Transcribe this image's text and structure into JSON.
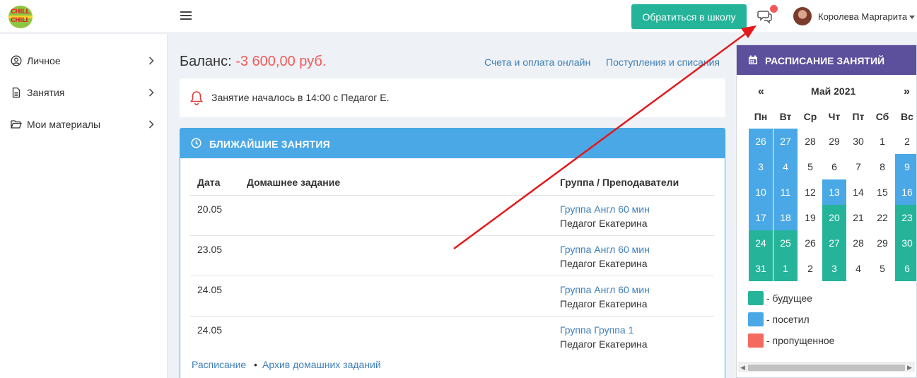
{
  "header": {
    "logo_line1": "CHILL",
    "logo_line2": "CHILI",
    "contact_button": "Обратиться в школу",
    "user_name": "Королева Маргарита"
  },
  "sidebar": {
    "items": [
      {
        "label": "Личное",
        "icon": "user-circle-icon"
      },
      {
        "label": "Занятия",
        "icon": "document-icon"
      },
      {
        "label": "Мои материалы",
        "icon": "folder-open-icon"
      }
    ]
  },
  "balance": {
    "label": "Баланс:",
    "amount": "-3 600,00 руб."
  },
  "links": {
    "invoices": "Счета и оплата онлайн",
    "transactions": "Поступления и списания"
  },
  "alert": {
    "text": "Занятие началось в 14:00 с Педагог Е."
  },
  "lessons": {
    "title": "БЛИЖАЙШИЕ ЗАНЯТИЯ",
    "columns": [
      "Дата",
      "Домашнее задание",
      "Группа / Преподаватели"
    ],
    "rows": [
      {
        "date": "20.05",
        "homework": "",
        "group": "Группа Англ 60 мин",
        "teacher": "Педагог Екатерина"
      },
      {
        "date": "23.05",
        "homework": "",
        "group": "Группа Англ 60 мин",
        "teacher": "Педагог Екатерина"
      },
      {
        "date": "24.05",
        "homework": "",
        "group": "Группа Англ 60 мин",
        "teacher": "Педагог Екатерина"
      },
      {
        "date": "24.05",
        "homework": "",
        "group": "Группа Группа 1",
        "teacher": "Педагог Екатерина"
      }
    ],
    "footer_links": [
      "Расписание",
      "Архив домашних заданий"
    ],
    "footer_separator": "•"
  },
  "calendar": {
    "title": "РАСПИСАНИЕ ЗАНЯТИЙ",
    "prev": "«",
    "next": "»",
    "month": "Май 2021",
    "weekdays": [
      "Пн",
      "Вт",
      "Ср",
      "Чт",
      "Пт",
      "Сб",
      "Вс"
    ],
    "weeks": [
      [
        {
          "d": "26",
          "s": "visited",
          "o": true
        },
        {
          "d": "27",
          "s": "visited",
          "o": true
        },
        {
          "d": "28",
          "s": "plain",
          "o": true
        },
        {
          "d": "29",
          "s": "plain",
          "o": true
        },
        {
          "d": "30",
          "s": "plain",
          "o": true
        },
        {
          "d": "1",
          "s": "plain",
          "o": false
        },
        {
          "d": "2",
          "s": "plain",
          "o": false
        }
      ],
      [
        {
          "d": "3",
          "s": "visited",
          "o": false
        },
        {
          "d": "4",
          "s": "visited",
          "o": false
        },
        {
          "d": "5",
          "s": "plain",
          "o": false
        },
        {
          "d": "6",
          "s": "plain",
          "o": false
        },
        {
          "d": "7",
          "s": "plain",
          "o": false
        },
        {
          "d": "8",
          "s": "plain",
          "o": false
        },
        {
          "d": "9",
          "s": "visited",
          "o": false
        }
      ],
      [
        {
          "d": "10",
          "s": "visited",
          "o": false
        },
        {
          "d": "11",
          "s": "visited",
          "o": false
        },
        {
          "d": "12",
          "s": "plain",
          "o": false
        },
        {
          "d": "13",
          "s": "visited",
          "o": false
        },
        {
          "d": "14",
          "s": "plain",
          "o": false
        },
        {
          "d": "15",
          "s": "plain",
          "o": false
        },
        {
          "d": "16",
          "s": "visited",
          "o": false
        }
      ],
      [
        {
          "d": "17",
          "s": "visited",
          "o": false
        },
        {
          "d": "18",
          "s": "visited",
          "o": false
        },
        {
          "d": "19",
          "s": "plain",
          "o": false
        },
        {
          "d": "20",
          "s": "future",
          "o": false
        },
        {
          "d": "21",
          "s": "plain",
          "o": false
        },
        {
          "d": "22",
          "s": "plain",
          "o": false
        },
        {
          "d": "23",
          "s": "future",
          "o": false
        }
      ],
      [
        {
          "d": "24",
          "s": "future",
          "o": false
        },
        {
          "d": "25",
          "s": "future",
          "o": false
        },
        {
          "d": "26",
          "s": "plain",
          "o": false
        },
        {
          "d": "27",
          "s": "future",
          "o": false
        },
        {
          "d": "28",
          "s": "plain",
          "o": false
        },
        {
          "d": "29",
          "s": "plain",
          "o": false
        },
        {
          "d": "30",
          "s": "future",
          "o": false
        }
      ],
      [
        {
          "d": "31",
          "s": "future",
          "o": false
        },
        {
          "d": "1",
          "s": "future",
          "o": true
        },
        {
          "d": "2",
          "s": "plain",
          "o": true
        },
        {
          "d": "3",
          "s": "future",
          "o": true
        },
        {
          "d": "4",
          "s": "plain",
          "o": true
        },
        {
          "d": "5",
          "s": "plain",
          "o": true
        },
        {
          "d": "6",
          "s": "future",
          "o": true
        }
      ]
    ],
    "legend": [
      {
        "label": "- будущее",
        "color": "#25b49a"
      },
      {
        "label": "- посетил",
        "color": "#4aa8e6"
      },
      {
        "label": "- пропущенное",
        "color": "#f36b5f"
      }
    ]
  },
  "colors": {
    "accent_green": "#25b49a",
    "accent_blue": "#4aa8e6",
    "calendar_header": "#5c4f9c",
    "negative": "#f05a5a",
    "annotation_arrow": "#e3191b"
  }
}
